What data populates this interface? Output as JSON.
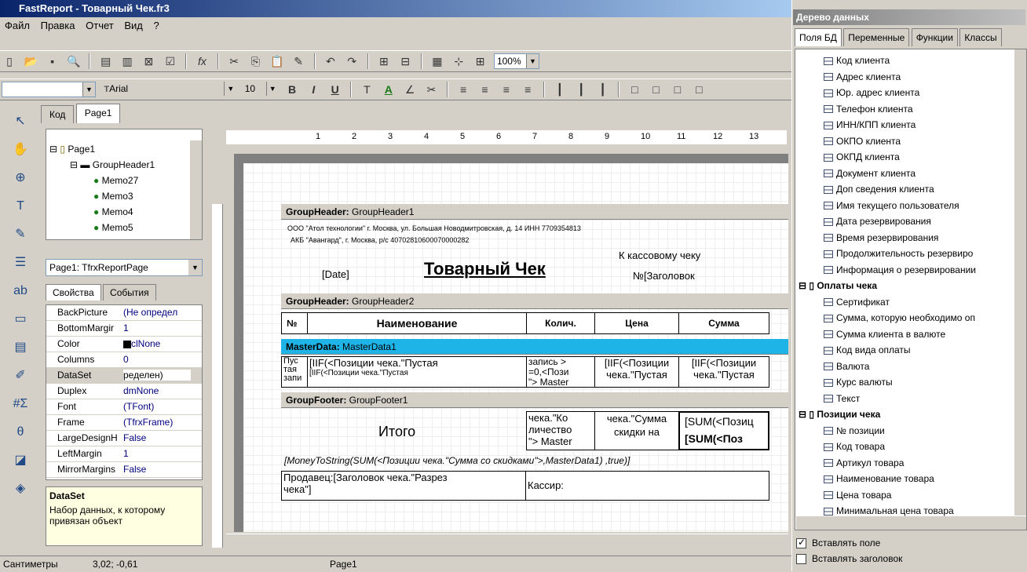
{
  "window": {
    "title": "FastReport - Товарный Чек.fr3"
  },
  "menu": [
    "Файл",
    "Правка",
    "Отчет",
    "Вид",
    "?"
  ],
  "toolbar2": {
    "font": "Arial",
    "size": "10",
    "zoom": "100%"
  },
  "tabs": [
    "Код",
    "Page1"
  ],
  "tree": {
    "items": [
      "Page1",
      "GroupHeader1",
      "Memo27",
      "Memo3",
      "Memo4",
      "Memo5"
    ]
  },
  "object_combo": "Page1: TfrxReportPage",
  "prop_tabs": [
    "Свойства",
    "События"
  ],
  "props": [
    {
      "name": "BackPicture",
      "value": "(Не определ"
    },
    {
      "name": "BottomMargir",
      "value": "1"
    },
    {
      "name": "Color",
      "value": "clNone"
    },
    {
      "name": "Columns",
      "value": "0"
    },
    {
      "name": "DataSet",
      "value": "ределен)"
    },
    {
      "name": "Duplex",
      "value": "dmNone"
    },
    {
      "name": "Font",
      "value": "(TFont)"
    },
    {
      "name": "Frame",
      "value": "(TfrxFrame)"
    },
    {
      "name": "LargeDesignH",
      "value": "False"
    },
    {
      "name": "LeftMargin",
      "value": "1"
    },
    {
      "name": "MirrorMargins",
      "value": "False"
    }
  ],
  "desc": {
    "title": "DataSet",
    "text": "Набор данных, к которому привязан объект"
  },
  "ruler": [
    "1",
    "2",
    "3",
    "4",
    "5",
    "6",
    "7",
    "8",
    "9",
    "10",
    "11",
    "12",
    "13"
  ],
  "bands": {
    "gh1": "GroupHeader:",
    "gh1n": "GroupHeader1",
    "gh2": "GroupHeader:",
    "gh2n": "GroupHeader2",
    "md": "MasterData:",
    "mdn": "MasterData1",
    "gf": "GroupFooter:",
    "gfn": "GroupFooter1"
  },
  "report": {
    "org": "ООО \"Атол технологии\" г. Москва, ул. Большая Новодмитровская, д. 14 ИНН 7709354813",
    "bank": "АКБ \"Авангард\", г. Москва, р/с 40702810600070000282",
    "date": "[Date]",
    "title": "Товарный Чек",
    "to_check1": "К кассовому чеку",
    "to_check2": "№[Заголовок",
    "h_no": "№",
    "h_name": "Наименование",
    "h_qty": "Колич.",
    "h_price": "Цена",
    "h_sum": "Сумма",
    "md1a": "Пус",
    "md1b": "тая",
    "md1c": "запи",
    "md2a": "[IIF(<Позиции чека.\"Пустая",
    "md2b": "[IIF(<Позиции чека.\"Пустая",
    "md3a": "запись >",
    "md3b": "=0,<Пози",
    "md3c": "\"> Master",
    "md4a": "[IIF(<Позиции",
    "md4b": "чека.\"Пустая",
    "md5a": "[IIF(<Позиции",
    "md5b": "чека.\"Пустая",
    "total": "Итого",
    "gf3a": "чека.\"Ко",
    "gf3b": "личество",
    "gf3c": "\"> Master",
    "gf4a": "чека.\"Сумма",
    "gf4b": "скидки на",
    "gf5a": "[SUM(<Позиц",
    "gf5b": "[SUM(<Поз",
    "money": "[MoneyToString(SUM(<Позиции чека.\"Сумма со скидками\">,MasterData1) ,true)]",
    "seller": "Продавец:[Заголовок чека.\"Разрез",
    "seller2": "чека\"]",
    "cashier": "Кассир:"
  },
  "status": {
    "units": "Сантиметры",
    "coords": "3,02; -0,61",
    "page": "Page1"
  },
  "rpanel": {
    "title": "Дерево данных",
    "tabs": [
      "Поля БД",
      "Переменные",
      "Функции",
      "Классы"
    ],
    "rows": [
      {
        "t": "Код клиента",
        "g": false
      },
      {
        "t": "Адрес клиента",
        "g": false
      },
      {
        "t": "Юр. адрес клиента",
        "g": false
      },
      {
        "t": "Телефон клиента",
        "g": false
      },
      {
        "t": "ИНН/КПП клиента",
        "g": false
      },
      {
        "t": "ОКПО клиента",
        "g": false
      },
      {
        "t": "ОКПД клиента",
        "g": false
      },
      {
        "t": "Документ клиента",
        "g": false
      },
      {
        "t": "Доп сведения клиента",
        "g": false
      },
      {
        "t": "Имя текущего пользователя",
        "g": false
      },
      {
        "t": "Дата резервирования",
        "g": false
      },
      {
        "t": "Время резервирования",
        "g": false
      },
      {
        "t": "Продолжительность резервиро",
        "g": false
      },
      {
        "t": "Информация о резервировании",
        "g": false
      },
      {
        "t": "Оплаты чека",
        "g": true
      },
      {
        "t": "Сертификат",
        "g": false
      },
      {
        "t": "Сумма, которую необходимо оп",
        "g": false
      },
      {
        "t": "Сумма клиента в валюте",
        "g": false
      },
      {
        "t": "Код вида оплаты",
        "g": false
      },
      {
        "t": "Валюта",
        "g": false
      },
      {
        "t": "Курс валюты",
        "g": false
      },
      {
        "t": "Текст",
        "g": false
      },
      {
        "t": "Позиции чека",
        "g": true
      },
      {
        "t": "№ позиции",
        "g": false
      },
      {
        "t": "Код товара",
        "g": false
      },
      {
        "t": "Артикул товара",
        "g": false
      },
      {
        "t": "Наименование товара",
        "g": false
      },
      {
        "t": "Цена товара",
        "g": false
      },
      {
        "t": "Минимальная цена товара",
        "g": false
      }
    ],
    "insert_field": "Вставлять поле",
    "insert_header": "Вставлять заголовок"
  }
}
